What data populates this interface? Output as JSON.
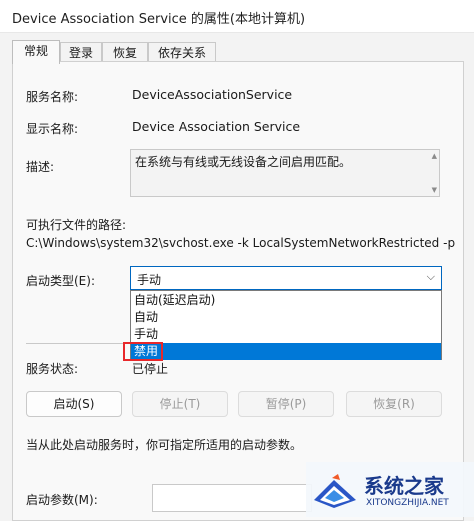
{
  "window": {
    "title": "Device Association Service 的属性(本地计算机)"
  },
  "tabs": [
    {
      "label": "常规",
      "active": true
    },
    {
      "label": "登录",
      "active": false
    },
    {
      "label": "恢复",
      "active": false
    },
    {
      "label": "依存关系",
      "active": false
    }
  ],
  "general": {
    "service_name_label": "服务名称:",
    "service_name": "DeviceAssociationService",
    "display_name_label": "显示名称:",
    "display_name": "Device Association Service",
    "description_label": "描述:",
    "description": "在系统与有线或无线设备之间启用匹配。",
    "exe_path_label": "可执行文件的路径:",
    "exe_path": "C:\\Windows\\system32\\svchost.exe -k LocalSystemNetworkRestricted -p",
    "startup_type_label": "启动类型(E):",
    "startup_type_value": "手动",
    "startup_options": [
      "自动(延迟启动)",
      "自动",
      "手动",
      "禁用"
    ],
    "highlighted_option": "禁用",
    "status_label": "服务状态:",
    "status_value": "已停止",
    "buttons": {
      "start": "启动(S)",
      "stop": "停止(T)",
      "pause": "暂停(P)",
      "resume": "恢复(R)"
    },
    "hint": "当从此处启动服务时，你可指定所适用的启动参数。",
    "params_label": "启动参数(M):"
  },
  "watermark": {
    "name": "系统之家",
    "url": "XITONGZHIJIA.NET"
  },
  "colors": {
    "accent": "#0078d7",
    "highlight_box": "#e8282b",
    "watermark": "#1a3a8c"
  }
}
